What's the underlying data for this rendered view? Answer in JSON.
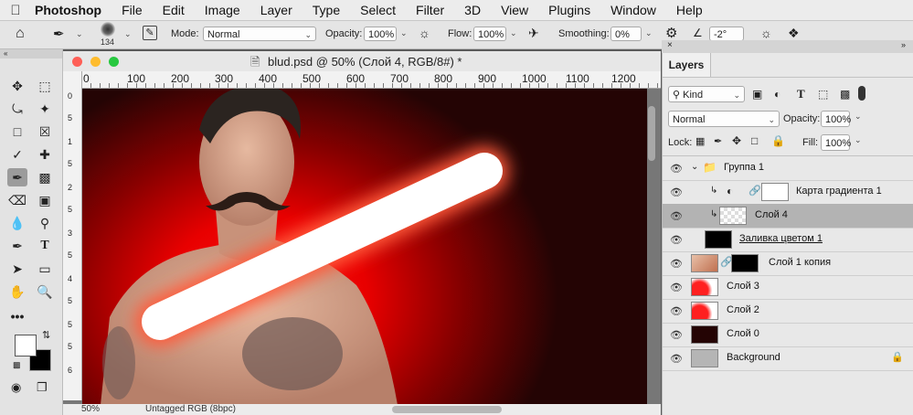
{
  "menubar": {
    "apple": "",
    "items": [
      "Photoshop",
      "File",
      "Edit",
      "Image",
      "Layer",
      "Type",
      "Select",
      "Filter",
      "3D",
      "View",
      "Plugins",
      "Window",
      "Help"
    ]
  },
  "options": {
    "brush_size": "134",
    "mode_label": "Mode:",
    "mode_value": "Normal",
    "opacity_label": "Opacity:",
    "opacity_value": "100%",
    "flow_label": "Flow:",
    "flow_value": "100%",
    "smoothing_label": "Smoothing:",
    "smoothing_value": "0%",
    "angle_value": "-2°"
  },
  "document": {
    "title": "blud.psd @ 50% (Слой 4, RGB/8#) *",
    "ruler_top": [
      "0",
      "100",
      "200",
      "300",
      "400",
      "500",
      "600",
      "700",
      "800",
      "900",
      "1000",
      "1100",
      "1200"
    ],
    "ruler_left": [
      "0",
      "5",
      "1",
      "5",
      "2",
      "5",
      "3",
      "5",
      "4",
      "5",
      "5",
      "5",
      "6"
    ],
    "zoom": "50%",
    "profile": "Untagged RGB (8bpc)"
  },
  "layers_panel": {
    "tab": "Layers",
    "filter_kind": "Kind",
    "blend_mode": "Normal",
    "opacity_label": "Opacity:",
    "opacity_value": "100%",
    "lock_label": "Lock:",
    "fill_label": "Fill:",
    "fill_value": "100%",
    "layers": [
      {
        "name": "Группа 1",
        "kind": "group"
      },
      {
        "name": "Карта градиента 1",
        "kind": "adjustment"
      },
      {
        "name": "Слой 4",
        "kind": "pixel",
        "selected": true
      },
      {
        "name": "Заливка цветом 1",
        "kind": "fill"
      },
      {
        "name": "Слой 1 копия",
        "kind": "masked"
      },
      {
        "name": "Слой 3",
        "kind": "pixel"
      },
      {
        "name": "Слой 2",
        "kind": "pixel"
      },
      {
        "name": "Слой 0",
        "kind": "pixel"
      },
      {
        "name": "Background",
        "kind": "background"
      }
    ]
  },
  "colors": {
    "foreground": "#ffffff",
    "background": "#000000",
    "canvas_red": "#ff1010",
    "canvas_dark": "#240404"
  }
}
